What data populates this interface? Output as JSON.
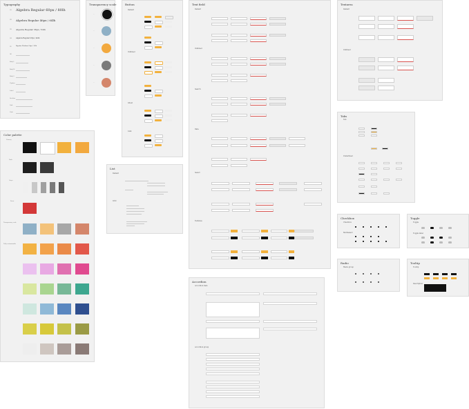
{
  "typography": {
    "title": "Typography",
    "samples": [
      "Algebra Regular 60px / 80lh",
      "Algebra Regular 46px / 64lh",
      "Algebra Regular 36px / 52lh",
      "Algebra Regular 28px / 40lh",
      "Algebra Medium 24px / 36lh"
    ],
    "labels": [
      "H1",
      "H2",
      "H3",
      "H4",
      "H5",
      "H6",
      "Body L",
      "Body M",
      "Body S",
      "Caption",
      "Label",
      "Overline",
      "Link",
      "Code"
    ]
  },
  "transparency": {
    "title": "Transparency scale"
  },
  "button": {
    "title": "Button",
    "sections": [
      "Default",
      "Outlined",
      "Ghost",
      "Link"
    ]
  },
  "textfield": {
    "title": "Text field",
    "sections": [
      "Default",
      "Outlined",
      "Search",
      "Date",
      "Select",
      "Textarea",
      "Phone"
    ]
  },
  "textarea": {
    "title": "Textarea",
    "sections": [
      "Default",
      "Outlined",
      "Filled"
    ]
  },
  "color": {
    "title": "Color palette",
    "rows": [
      "Primary",
      "Dark",
      "Grays",
      "Error",
      "Transparency scale",
      "Fully customizable"
    ],
    "primary": [
      "#111111",
      "#ffffff",
      "#f2b13d",
      "#f2a93f"
    ],
    "dark": [
      "#1e1e1e",
      "#3a3a3a"
    ],
    "grays": [
      "#f0f0f0",
      "#c8c8c8",
      "#a0a0a0",
      "#7a7a7a"
    ],
    "error": [
      "#d33838"
    ],
    "blues": [
      "#8fb0c6",
      "#f3c27a",
      "#a7a7a7",
      "#d4866b"
    ],
    "extra": [
      [
        "#f2b244",
        "#f2a24b",
        "#ea8a48",
        "#e2584a"
      ],
      [
        "#ebc1ef",
        "#e8a9e3",
        "#e070b0",
        "#e04a8f"
      ],
      [
        "#d9e7a0",
        "#a9d590",
        "#77b897",
        "#3da78f"
      ],
      [
        "#cfe7df",
        "#8fb9d7",
        "#5a87c0",
        "#2f4f8f"
      ],
      [
        "#d9cf4a",
        "#d7c93a",
        "#c4c14a",
        "#9a9a45"
      ],
      [
        "#eeeeee",
        "#cfc6c0",
        "#a99c98",
        "#8a7a76"
      ]
    ]
  },
  "list": {
    "title": "List",
    "sections": [
      "Default",
      "Grid"
    ]
  },
  "tabs": {
    "title": "Tabs",
    "sections": [
      "Tab",
      "Underlined"
    ]
  },
  "checkbox": {
    "title": "Checkbox",
    "sections": [
      "Checkbox",
      "Multiselect"
    ]
  },
  "toggle": {
    "title": "Toggle",
    "sections": [
      "Toggle",
      "Toggle label"
    ]
  },
  "radio": {
    "title": "Radio",
    "sections": [
      "Radio group"
    ]
  },
  "tooltip": {
    "title": "Tooltip",
    "sections": [
      "Tooltip",
      "Description"
    ]
  },
  "accordion": {
    "title": "Accordion",
    "sections": [
      "Accordion item",
      "Accordion group"
    ]
  }
}
